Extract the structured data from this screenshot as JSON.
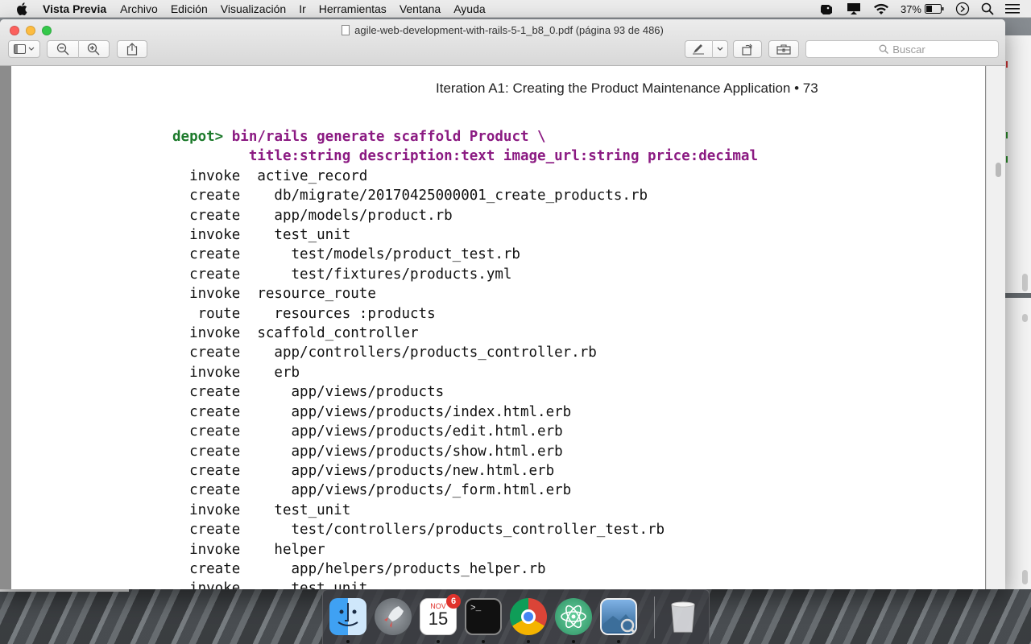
{
  "menubar": {
    "app_name": "Vista Previa",
    "items": [
      "Archivo",
      "Edición",
      "Visualización",
      "Ir",
      "Herramientas",
      "Ventana",
      "Ayuda"
    ],
    "battery_percent": "37%"
  },
  "window": {
    "title": "agile-web-development-with-rails-5-1_b8_0.pdf (página 93 de 486)",
    "search_placeholder": "Buscar"
  },
  "page": {
    "running_head": "Iteration A1: Creating the Product Maintenance Application • 73",
    "code_prompt": "depot>",
    "code_command_1": "bin/rails generate scaffold Product \\",
    "code_command_2": "title:string description:text image_url:string price:decimal",
    "code_lines": [
      "  invoke  active_record",
      "  create    db/migrate/20170425000001_create_products.rb",
      "  create    app/models/product.rb",
      "  invoke    test_unit",
      "  create      test/models/product_test.rb",
      "  create      test/fixtures/products.yml",
      "  invoke  resource_route",
      "   route    resources :products",
      "  invoke  scaffold_controller",
      "  create    app/controllers/products_controller.rb",
      "  invoke    erb",
      "  create      app/views/products",
      "  create      app/views/products/index.html.erb",
      "  create      app/views/products/edit.html.erb",
      "  create      app/views/products/show.html.erb",
      "  create      app/views/products/new.html.erb",
      "  create      app/views/products/_form.html.erb",
      "  invoke    test_unit",
      "  create      test/controllers/products_controller_test.rb",
      "  invoke    helper",
      "  create      app/helpers/products_helper.rb",
      "  invoke      test_unit"
    ]
  },
  "dock": {
    "calendar_month": "NOV",
    "calendar_day": "15",
    "calendar_badge": "6",
    "terminal_prompt": ">_"
  },
  "colors": {
    "prompt": "#1c7a2b",
    "command": "#8b1a82"
  }
}
